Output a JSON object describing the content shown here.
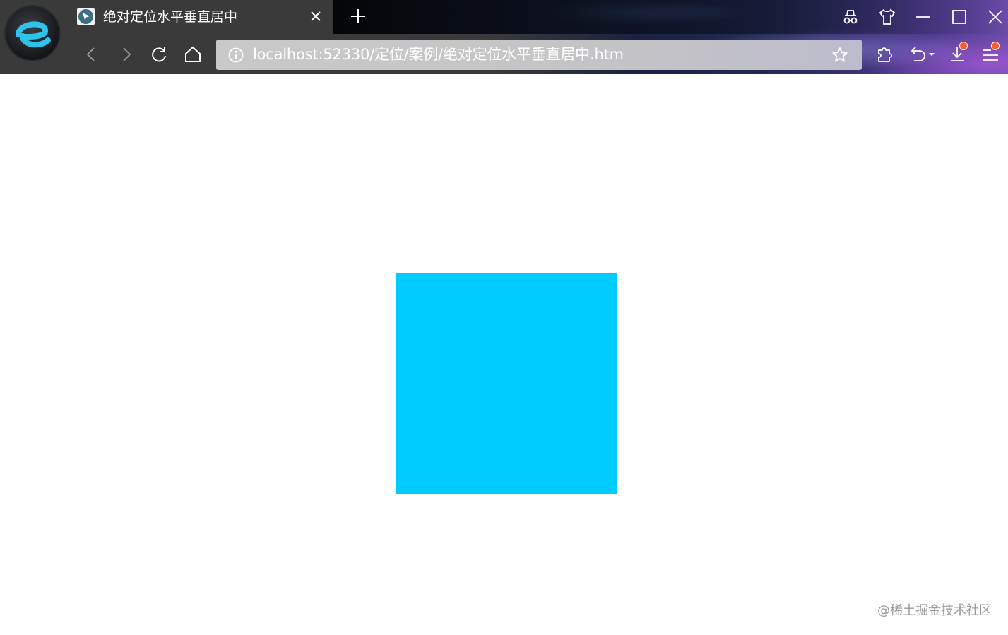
{
  "browser": {
    "tab": {
      "title": "绝对定位水平垂直居中",
      "close_icon": "close-icon",
      "favicon": "cursor-favicon-icon"
    },
    "new_tab_icon": "plus-icon",
    "window_controls": [
      "incognito-icon",
      "skin-shirt-icon",
      "minimize-icon",
      "maximize-icon",
      "close-window-icon"
    ],
    "nav_icons": [
      "back-arrow-icon",
      "forward-arrow-icon",
      "reload-icon",
      "home-icon"
    ],
    "address": {
      "url": "localhost:52330/定位/案例/绝对定位水平垂直居中.htm",
      "info_icon": "info-icon",
      "bookmark_icon": "star-icon"
    },
    "toolbar_icons": [
      "extensions-puzzle-icon",
      "undo-close-tab-icon",
      "download-icon",
      "menu-icon"
    ]
  },
  "page": {
    "box_color": "#00ccff",
    "watermark": "@稀土掘金技术社区"
  },
  "colors": {
    "chrome_background": "#3a3a3a",
    "address_bar": "#c9c9c9",
    "badge": "#ff5a2a"
  }
}
